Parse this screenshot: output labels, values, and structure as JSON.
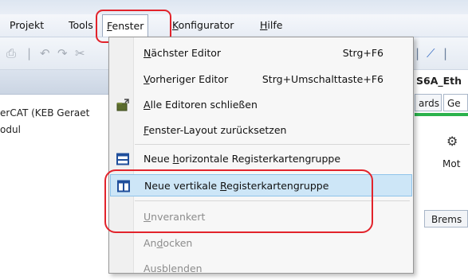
{
  "menubar": {
    "items": [
      {
        "label": "Projekt"
      },
      {
        "label": "Tools"
      },
      {
        "label_pre": "",
        "label_ul": "F",
        "label_post": "enster"
      },
      {
        "label_pre": "",
        "label_ul": "K",
        "label_post": "onfigurator"
      },
      {
        "label_pre": "",
        "label_ul": "H",
        "label_post": "ilfe"
      }
    ]
  },
  "left_pane": {
    "tree": [
      {
        "label": "erCAT (KEB Geraet"
      },
      {
        "label": "odul"
      }
    ]
  },
  "right_pane": {
    "title": "S6A_Eth",
    "tabs": [
      {
        "label": "ards"
      },
      {
        "label": "Ge"
      }
    ],
    "mot_label": "Mot",
    "brems_label": "Brems"
  },
  "fenster_menu": {
    "items": [
      {
        "pre": "",
        "ul": "N",
        "post": "ächster Editor",
        "shortcut": "Strg+F6"
      },
      {
        "pre": "",
        "ul": "V",
        "post": "orheriger Editor",
        "shortcut": "Strg+Umschalttaste+F6"
      },
      {
        "pre": "",
        "ul": "A",
        "post": "lle Editoren schließen",
        "shortcut": "",
        "icon": "close-all-editors-icon"
      },
      {
        "pre": "",
        "ul": "F",
        "post": "enster-Layout zurücksetzen",
        "shortcut": ""
      },
      {
        "pre": "Neue ",
        "ul": "h",
        "post": "orizontale Registerkartengruppe",
        "shortcut": "",
        "icon": "horizontal-tab-group-icon"
      },
      {
        "pre": "Neue vertikale ",
        "ul": "R",
        "post": "egisterkartengruppe",
        "shortcut": "",
        "icon": "vertical-tab-group-icon"
      },
      {
        "pre": "",
        "ul": "U",
        "post": "nverankert",
        "shortcut": "",
        "disabled": true
      },
      {
        "pre": "An",
        "ul": "d",
        "post": "ocken",
        "shortcut": "",
        "disabled": true
      },
      {
        "pre": "Ausblenden",
        "ul": "",
        "post": "",
        "shortcut": "",
        "disabled": true
      }
    ]
  },
  "colors": {
    "highlight_red": "#e2232b",
    "hover_blue": "#cde6f7",
    "icon_blue": "#1f4e9b"
  }
}
